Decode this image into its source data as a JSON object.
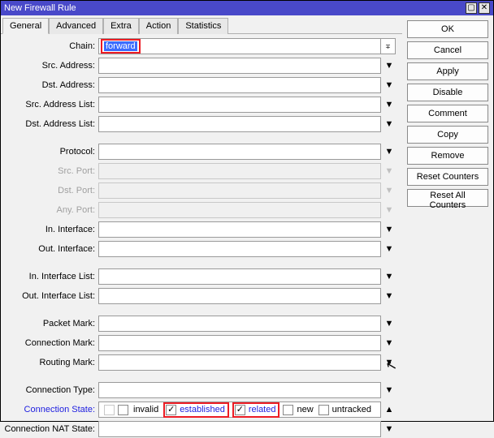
{
  "window": {
    "title": "New Firewall Rule"
  },
  "tabs": [
    "General",
    "Advanced",
    "Extra",
    "Action",
    "Statistics"
  ],
  "buttons": {
    "ok": "OK",
    "cancel": "Cancel",
    "apply": "Apply",
    "disable": "Disable",
    "comment": "Comment",
    "copy": "Copy",
    "remove": "Remove",
    "reset_counters": "Reset Counters",
    "reset_all_counters": "Reset All Counters"
  },
  "labels": {
    "chain": "Chain:",
    "src_address": "Src. Address:",
    "dst_address": "Dst. Address:",
    "src_address_list": "Src. Address List:",
    "dst_address_list": "Dst. Address List:",
    "protocol": "Protocol:",
    "src_port": "Src. Port:",
    "dst_port": "Dst. Port:",
    "any_port": "Any. Port:",
    "in_interface": "In. Interface:",
    "out_interface": "Out. Interface:",
    "in_interface_list": "In. Interface List:",
    "out_interface_list": "Out. Interface List:",
    "packet_mark": "Packet Mark:",
    "connection_mark": "Connection Mark:",
    "routing_mark": "Routing Mark:",
    "connection_type": "Connection Type:",
    "connection_state": "Connection State:",
    "connection_nat_state": "Connection NAT State:"
  },
  "values": {
    "chain": "forward"
  },
  "conn_state": {
    "invalid": {
      "label": "invalid",
      "checked": false,
      "highlight": false
    },
    "established": {
      "label": "established",
      "checked": true,
      "highlight": true
    },
    "related": {
      "label": "related",
      "checked": true,
      "highlight": true
    },
    "new": {
      "label": "new",
      "checked": false,
      "highlight": false
    },
    "untracked": {
      "label": "untracked",
      "checked": false,
      "highlight": false
    }
  }
}
